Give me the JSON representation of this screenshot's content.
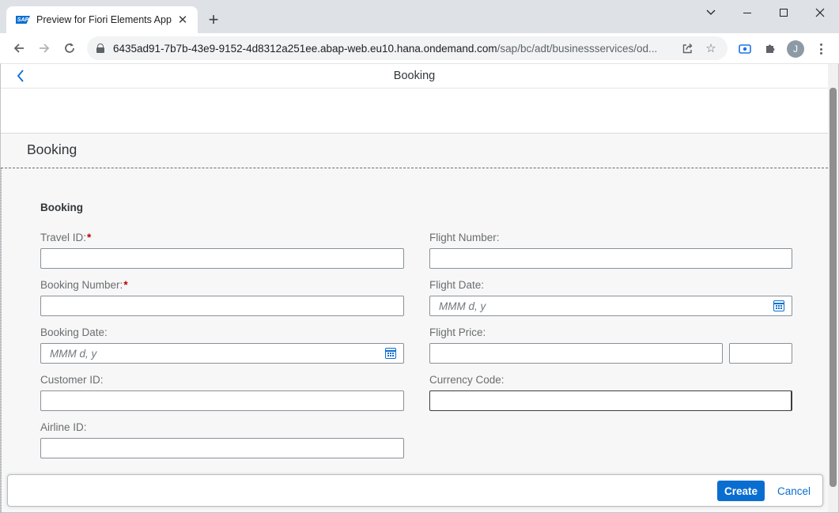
{
  "browser": {
    "tab_title": "Preview for Fiori Elements App",
    "tab_favicon_text": "SAP",
    "url_host": "6435ad91-7b7b-43e9-9152-4d8312a251ee.abap-web.eu10.hana.ondemand.com",
    "url_path": "/sap/bc/adt/businessservices/od...",
    "profile_initial": "J"
  },
  "shell": {
    "title": "Booking"
  },
  "object_page": {
    "title": "Booking",
    "section_title": "Booking"
  },
  "form": {
    "left": [
      {
        "label": "Travel ID:",
        "required": "*",
        "value": ""
      },
      {
        "label": "Booking Number:",
        "required": "*",
        "value": ""
      },
      {
        "label": "Booking Date:",
        "placeholder": "MMM d, y"
      },
      {
        "label": "Customer ID:",
        "value": ""
      },
      {
        "label": "Airline ID:",
        "value": ""
      }
    ],
    "right": [
      {
        "label": "Flight Number:",
        "value": ""
      },
      {
        "label": "Flight Date:",
        "placeholder": "MMM d, y"
      },
      {
        "label": "Flight Price:",
        "value": "",
        "currency": ""
      },
      {
        "label": "Currency Code:",
        "value": ""
      }
    ]
  },
  "footer": {
    "create_label": "Create",
    "cancel_label": "Cancel"
  },
  "colors": {
    "accent": "#0a6ed1",
    "required": "#bb0000",
    "background": "#f7f7f7"
  }
}
